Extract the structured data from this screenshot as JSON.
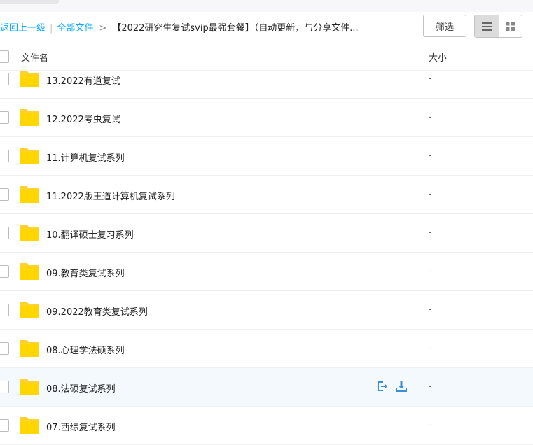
{
  "breadcrumb": {
    "back_label": "返回上一级",
    "separator": "|",
    "all_files_label": "全部文件",
    "arrow": ">",
    "current_folder": "【2022研究生复试svip最强套餐】（自动更新，与分享文件..."
  },
  "toolbar": {
    "filter_label": "筛选",
    "view_list_icon": "list-view-icon",
    "view_grid_icon": "grid-view-icon"
  },
  "table": {
    "header_name": "文件名",
    "header_size": "大小"
  },
  "files": [
    {
      "name": "13.2022有道复试",
      "size": "-"
    },
    {
      "name": "12.2022考虫复试",
      "size": "-"
    },
    {
      "name": "11.计算机复试系列",
      "size": "-"
    },
    {
      "name": "11.2022版王道计算机复试系列",
      "size": "-"
    },
    {
      "name": "10.翻译硕士复习系列",
      "size": "-"
    },
    {
      "name": "09.教育类复试系列",
      "size": "-"
    },
    {
      "name": "09.2022教育类复试系列",
      "size": "-"
    },
    {
      "name": "08.心理学法硕系列",
      "size": "-"
    },
    {
      "name": "08.法硕复试系列",
      "size": "-"
    },
    {
      "name": "07.西综复试系列",
      "size": "-"
    }
  ],
  "colors": {
    "link": "#09aaff",
    "folder": "#ffd22e",
    "action_icon": "#3b8fd9",
    "hover_row": "#f4f9fe"
  }
}
